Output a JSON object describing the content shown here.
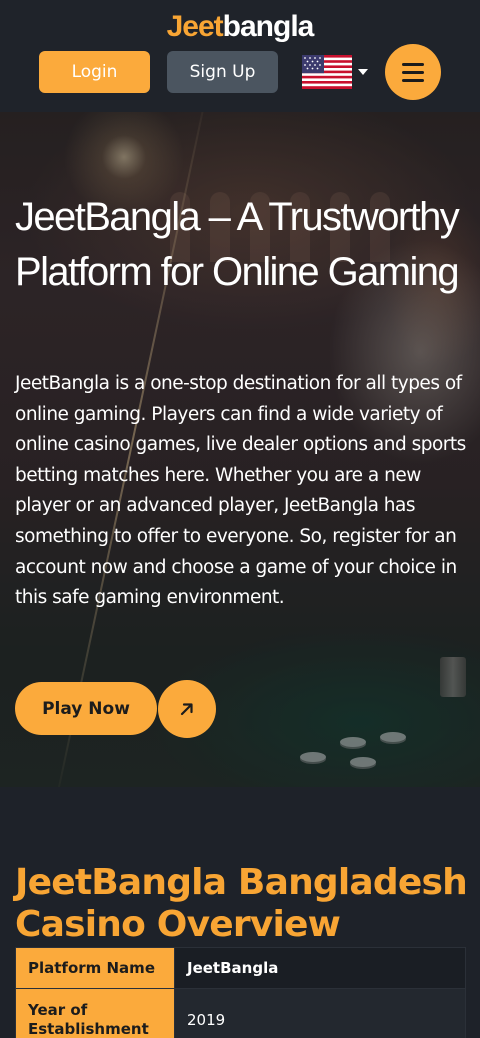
{
  "header": {
    "logo": {
      "part1": "Jeet",
      "part2": "bangla"
    },
    "login_label": "Login",
    "signup_label": "Sign Up",
    "language_icon": "us-flag-icon",
    "menu_icon": "hamburger-menu-icon"
  },
  "hero": {
    "title": "JeetBangla – A Trustworthy Platform for Online Gaming",
    "description": "JeetBangla is a one-stop destination for all types of online gaming. Players can find a wide variety of online casino games, live dealer options and sports betting matches here. Whether you are a new player or an advanced player, JeetBangla has something to offer to everyone. So, register for an account now and choose a game of your choice in this safe gaming environment.",
    "play_label": "Play Now",
    "arrow_icon": "arrow-up-right-icon"
  },
  "overview": {
    "title": "JeetBangla Bangladesh Casino Overview",
    "rows": [
      {
        "key": "Platform Name",
        "value": "JeetBangla"
      },
      {
        "key": "Year of Establishment",
        "value": "2019"
      }
    ]
  },
  "colors": {
    "accent": "#fbaa3c",
    "background": "#1e2229",
    "button_secondary": "#4b5560"
  }
}
